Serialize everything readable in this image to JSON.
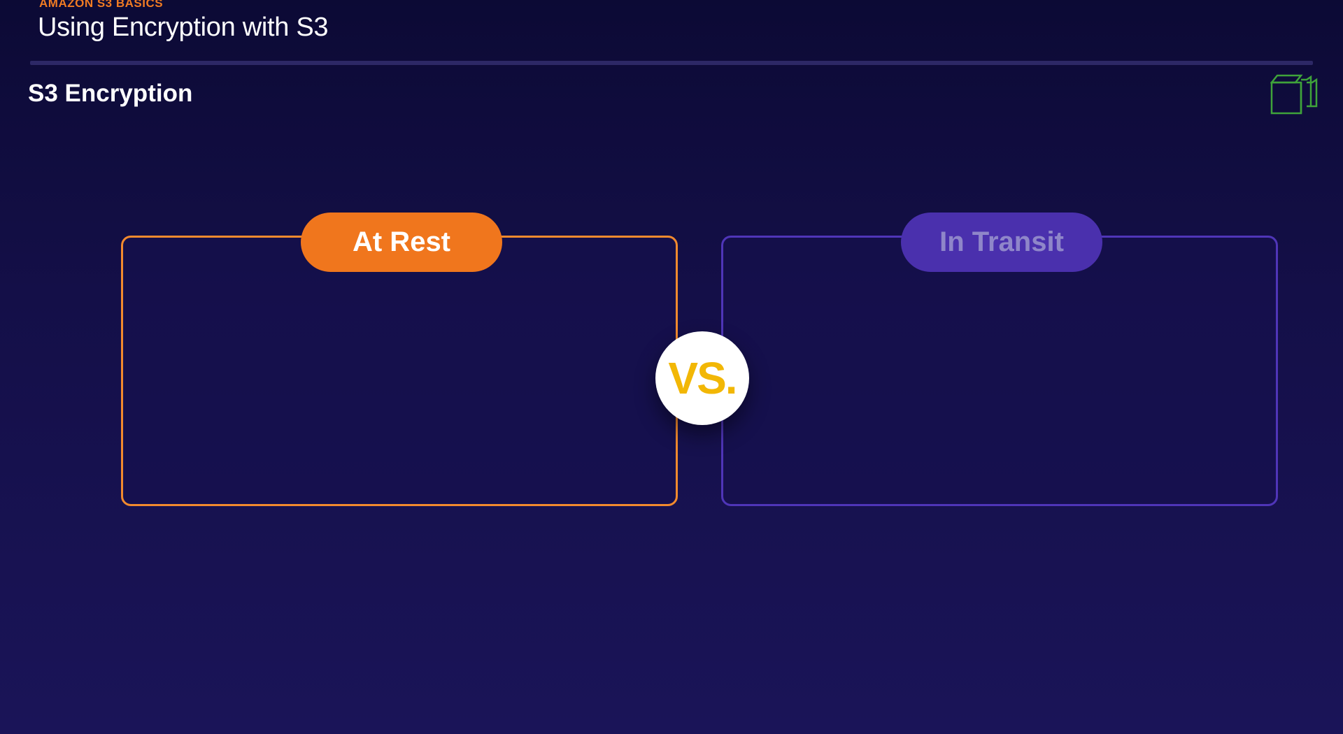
{
  "header": {
    "eyebrow": "AMAZON S3 BASICS",
    "title": "Using Encryption with S3"
  },
  "section": {
    "title": "S3 Encryption",
    "icon": "s3-stack-icon"
  },
  "comparison": {
    "left_label": "At Rest",
    "right_label": "In Transit",
    "vs_label": "VS.",
    "left_color": "#f0761d",
    "right_color": "#4a30ad",
    "vs_color": "#f2b705"
  }
}
